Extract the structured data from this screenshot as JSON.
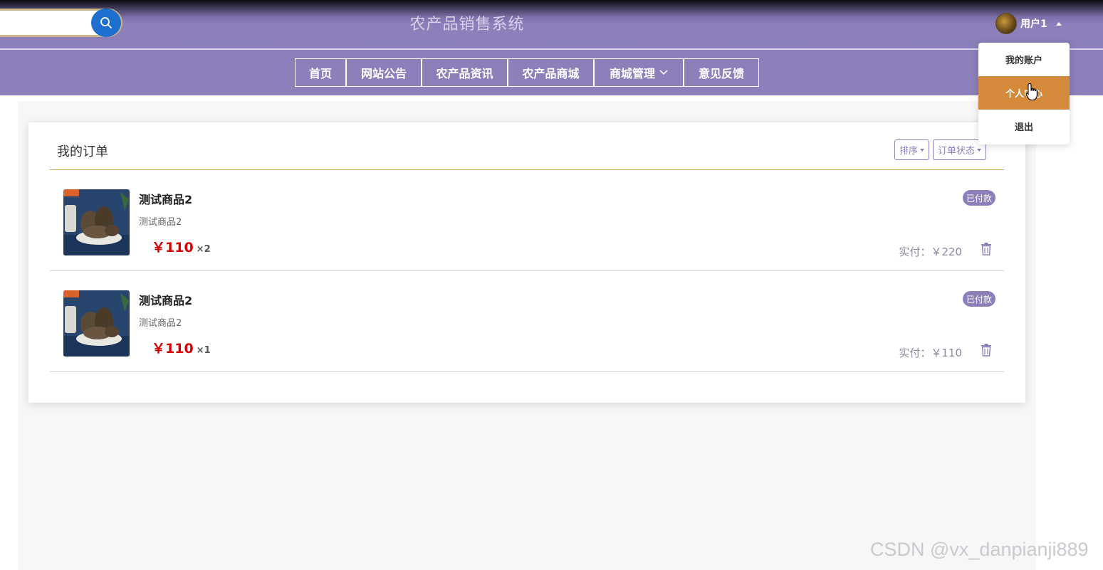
{
  "header": {
    "site_title": "农产品销售系统",
    "user_name": "用户1"
  },
  "nav": {
    "items": [
      "首页",
      "网站公告",
      "农产品资讯",
      "农产品商城",
      "商城管理",
      "意见反馈"
    ]
  },
  "user_menu": {
    "items": [
      "我的账户",
      "个人中心",
      "退出"
    ],
    "active_index": 1
  },
  "orders_panel": {
    "title": "我的订单",
    "sort_label": "排序",
    "status_filter_label": "订单状态",
    "orders": [
      {
        "name": "测试商品2",
        "description": "测试商品2",
        "price": "￥110",
        "quantity": "×2",
        "status": "已付款",
        "paid_label": "实付：￥220"
      },
      {
        "name": "测试商品2",
        "description": "测试商品2",
        "price": "￥110",
        "quantity": "×1",
        "status": "已付款",
        "paid_label": "实付：￥110"
      }
    ]
  },
  "watermark": "CSDN @vx_danpianji889",
  "colors": {
    "header_purple": "#8c7fba",
    "accent_orange": "#d4893b",
    "price_red": "#d60000",
    "badge_purple": "#8c7fba"
  },
  "icons": [
    "search-icon",
    "chevron-down-icon",
    "caret-up-icon",
    "trash-icon",
    "hand-pointer-icon"
  ]
}
